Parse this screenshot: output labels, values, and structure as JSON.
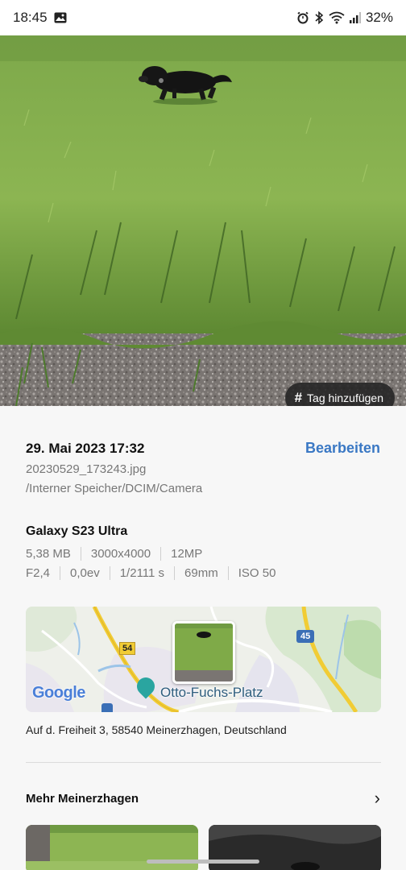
{
  "status_bar": {
    "time": "18:45",
    "battery": "32%",
    "icons": [
      "gallery-icon",
      "alarm-icon",
      "bluetooth-icon",
      "wifi-icon",
      "signal-icon"
    ]
  },
  "photo": {
    "tag_button_label": "Tag hinzufügen"
  },
  "details": {
    "date": "29. Mai 2023 17:32",
    "edit_label": "Bearbeiten",
    "filename": "20230529_173243.jpg",
    "path": "/Interner Speicher/DCIM/Camera",
    "device": "Galaxy S23 Ultra",
    "specs_row1": [
      "5,38 MB",
      "3000x4000",
      "12MP"
    ],
    "specs_row2": [
      "F2,4",
      "0,0ev",
      "1/2111 s",
      "69mm",
      "ISO 50"
    ]
  },
  "map": {
    "brand": "Google",
    "place_label": "Otto-Fuchs-Platz",
    "road_54": "54",
    "road_45": "45"
  },
  "address": "Auf d. Freiheit 3, 58540 Meinerzhagen, Deutschland",
  "more": {
    "title": "Mehr Meinerzhagen"
  },
  "colors": {
    "accent": "#3a78c4",
    "background": "#f7f7f7"
  }
}
